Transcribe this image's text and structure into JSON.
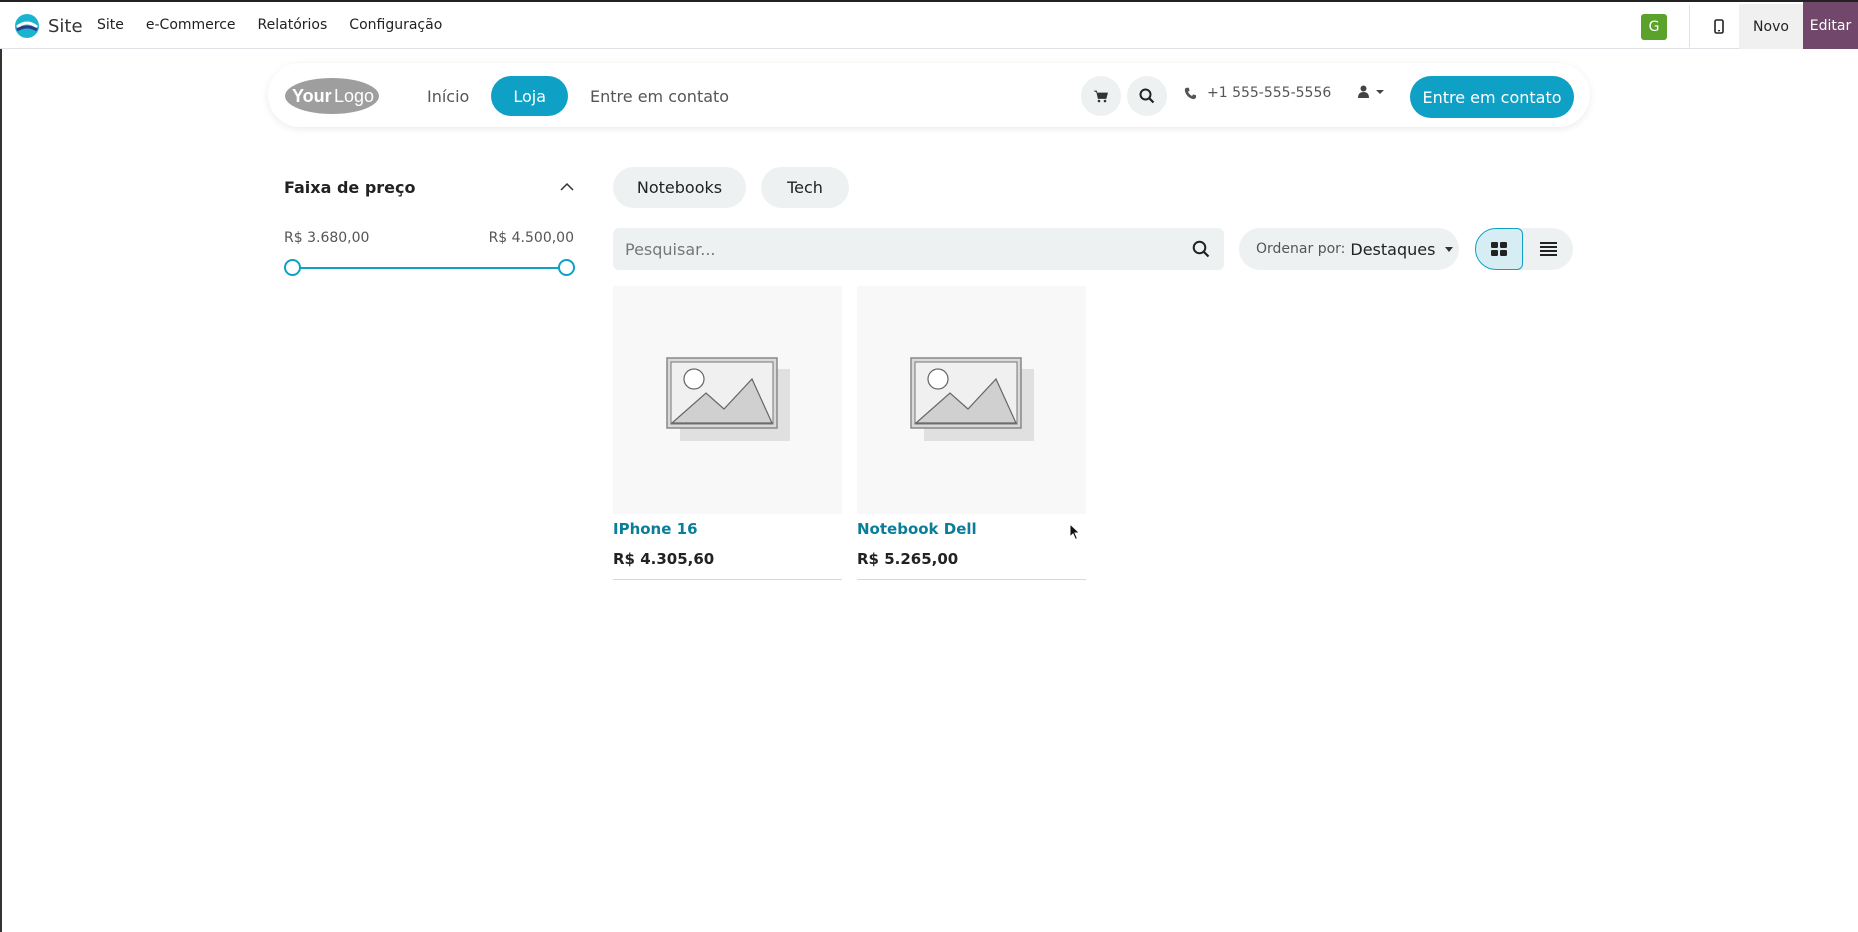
{
  "adminbar": {
    "app_name": "Site",
    "menu": [
      "Site",
      "e-Commerce",
      "Relatórios",
      "Configuração"
    ],
    "user_initial": "G",
    "new_label": "Novo",
    "edit_label": "Editar"
  },
  "header": {
    "logo_text": "YourLogo",
    "nav": [
      {
        "label": "Início",
        "active": false
      },
      {
        "label": "Loja",
        "active": true
      },
      {
        "label": "Entre em contato",
        "active": false
      }
    ],
    "phone": "+1 555-555-5556",
    "cta_label": "Entre em contato"
  },
  "filter": {
    "title": "Faixa de preço",
    "min_label": "R$ 3.680,00",
    "max_label": "R$ 4.500,00"
  },
  "categories": [
    "Notebooks",
    "Tech"
  ],
  "search": {
    "placeholder": "Pesquisar..."
  },
  "sort": {
    "label": "Ordenar por:",
    "value": "Destaques"
  },
  "products": [
    {
      "name": "IPhone 16",
      "price": "R$ 4.305,60"
    },
    {
      "name": "Notebook Dell",
      "price": "R$ 5.265,00"
    }
  ],
  "colors": {
    "accent": "#0ea1c5",
    "edit_button": "#71476b",
    "avatar": "#5aa22a",
    "product_link": "#0a7d99"
  }
}
